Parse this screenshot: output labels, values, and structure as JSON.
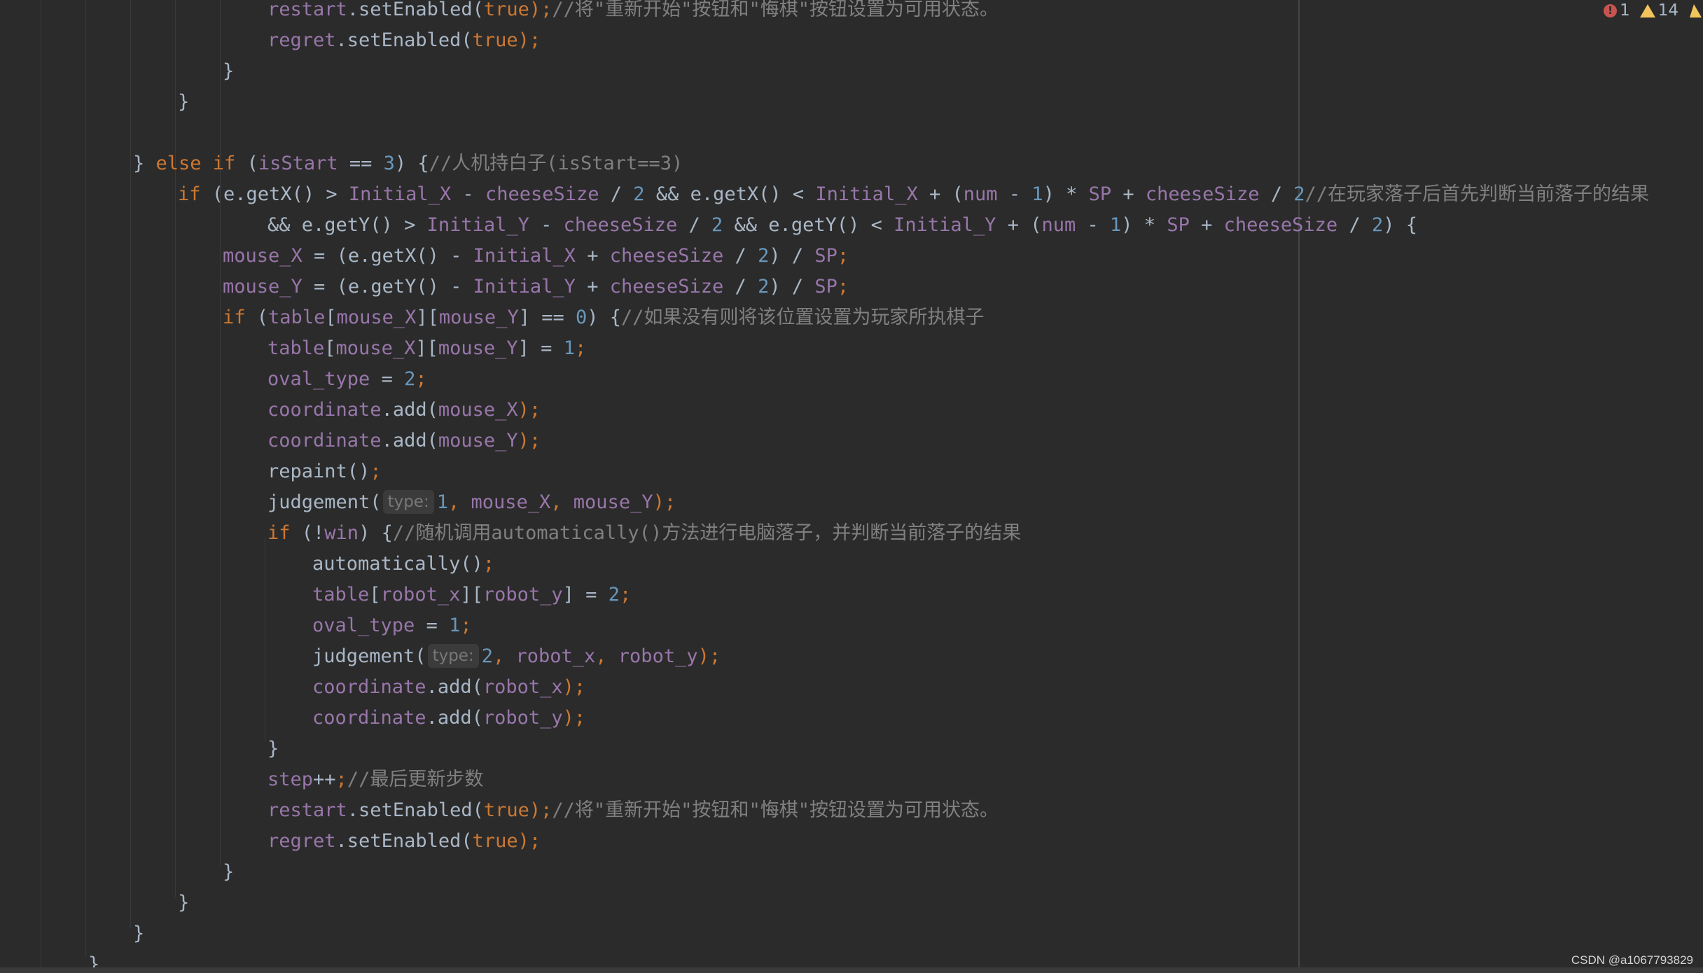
{
  "status": {
    "error_count": "1",
    "warning_count": "14",
    "error_icon": "error-circle-icon",
    "warning_icon": "warning-triangle-icon"
  },
  "watermark": "CSDN @a1067793829",
  "colors": {
    "background": "#2b2b2b",
    "keyword": "#cc7832",
    "field": "#9876aa",
    "number": "#6897bb",
    "comment": "#808080",
    "plain": "#a9b7c6"
  },
  "code_lines": [
    [
      [
        "restart",
        "fld"
      ],
      [
        ".setEnabled(",
        "pl"
      ],
      [
        "true",
        "kw"
      ],
      [
        ");",
        "kw"
      ],
      [
        "//将\"重新开始\"按钮和\"悔棋\"按钮设置为可用状态。",
        "cmt"
      ]
    ],
    [
      [
        "regret",
        "fld"
      ],
      [
        ".setEnabled(",
        "pl"
      ],
      [
        "true",
        "kw"
      ],
      [
        ");",
        "kw"
      ]
    ],
    [
      [
        "}",
        "pl"
      ]
    ],
    [
      [
        "}",
        "pl"
      ]
    ],
    [],
    [
      [
        "} ",
        "pl"
      ],
      [
        "else if ",
        "kw"
      ],
      [
        "(",
        "pl"
      ],
      [
        "isStart",
        "fld"
      ],
      [
        " == ",
        "pl"
      ],
      [
        "3",
        "num"
      ],
      [
        ") {",
        "pl"
      ],
      [
        "//人机持白子(isStart==3)",
        "cmt"
      ]
    ],
    [
      [
        "if ",
        "kw"
      ],
      [
        "(e.getX() > ",
        "pl"
      ],
      [
        "Initial_X",
        "fld"
      ],
      [
        " - ",
        "pl"
      ],
      [
        "cheeseSize",
        "fld"
      ],
      [
        " / ",
        "pl"
      ],
      [
        "2",
        "num"
      ],
      [
        " && e.getX() < ",
        "pl"
      ],
      [
        "Initial_X",
        "fld"
      ],
      [
        " + (",
        "pl"
      ],
      [
        "num",
        "fld"
      ],
      [
        " - ",
        "pl"
      ],
      [
        "1",
        "num"
      ],
      [
        ") * ",
        "pl"
      ],
      [
        "SP",
        "fld"
      ],
      [
        " + ",
        "pl"
      ],
      [
        "cheeseSize",
        "fld"
      ],
      [
        " / ",
        "pl"
      ],
      [
        "2",
        "num"
      ],
      [
        "//在玩家落子后首先判断当前落子的结果",
        "cmt"
      ]
    ],
    [
      [
        "&& e.getY() > ",
        "pl"
      ],
      [
        "Initial_Y",
        "fld"
      ],
      [
        " - ",
        "pl"
      ],
      [
        "cheeseSize",
        "fld"
      ],
      [
        " / ",
        "pl"
      ],
      [
        "2",
        "num"
      ],
      [
        " && e.getY() < ",
        "pl"
      ],
      [
        "Initial_Y",
        "fld"
      ],
      [
        " + (",
        "pl"
      ],
      [
        "num",
        "fld"
      ],
      [
        " - ",
        "pl"
      ],
      [
        "1",
        "num"
      ],
      [
        ") * ",
        "pl"
      ],
      [
        "SP",
        "fld"
      ],
      [
        " + ",
        "pl"
      ],
      [
        "cheeseSize",
        "fld"
      ],
      [
        " / ",
        "pl"
      ],
      [
        "2",
        "num"
      ],
      [
        ") {",
        "pl"
      ]
    ],
    [
      [
        "mouse_X",
        "fld"
      ],
      [
        " = (e.getX() - ",
        "pl"
      ],
      [
        "Initial_X",
        "fld"
      ],
      [
        " + ",
        "pl"
      ],
      [
        "cheeseSize",
        "fld"
      ],
      [
        " / ",
        "pl"
      ],
      [
        "2",
        "num"
      ],
      [
        ") / ",
        "pl"
      ],
      [
        "SP",
        "fld"
      ],
      [
        ";",
        "kw"
      ]
    ],
    [
      [
        "mouse_Y",
        "fld"
      ],
      [
        " = (e.getY() - ",
        "pl"
      ],
      [
        "Initial_Y",
        "fld"
      ],
      [
        " + ",
        "pl"
      ],
      [
        "cheeseSize",
        "fld"
      ],
      [
        " / ",
        "pl"
      ],
      [
        "2",
        "num"
      ],
      [
        ") / ",
        "pl"
      ],
      [
        "SP",
        "fld"
      ],
      [
        ";",
        "kw"
      ]
    ],
    [
      [
        "if ",
        "kw"
      ],
      [
        "(",
        "pl"
      ],
      [
        "table",
        "fld"
      ],
      [
        "[",
        "pl"
      ],
      [
        "mouse_X",
        "fld"
      ],
      [
        "][",
        "pl"
      ],
      [
        "mouse_Y",
        "fld"
      ],
      [
        "] == ",
        "pl"
      ],
      [
        "0",
        "num"
      ],
      [
        ") {",
        "pl"
      ],
      [
        "//如果没有则将该位置设置为玩家所执棋子",
        "cmt"
      ]
    ],
    [
      [
        "table",
        "fld"
      ],
      [
        "[",
        "pl"
      ],
      [
        "mouse_X",
        "fld"
      ],
      [
        "][",
        "pl"
      ],
      [
        "mouse_Y",
        "fld"
      ],
      [
        "] = ",
        "pl"
      ],
      [
        "1",
        "num"
      ],
      [
        ";",
        "kw"
      ]
    ],
    [
      [
        "oval_type",
        "fld"
      ],
      [
        " = ",
        "pl"
      ],
      [
        "2",
        "num"
      ],
      [
        ";",
        "kw"
      ]
    ],
    [
      [
        "coordinate",
        "fld"
      ],
      [
        ".add(",
        "pl"
      ],
      [
        "mouse_X",
        "fld"
      ],
      [
        ");",
        "kw"
      ]
    ],
    [
      [
        "coordinate",
        "fld"
      ],
      [
        ".add(",
        "pl"
      ],
      [
        "mouse_Y",
        "fld"
      ],
      [
        ");",
        "kw"
      ]
    ],
    [
      [
        "repaint()",
        "pl"
      ],
      [
        ";",
        "kw"
      ]
    ],
    [
      [
        "judgement(",
        "pl"
      ],
      [
        "type:",
        "hint"
      ],
      [
        "1",
        "num"
      ],
      [
        ", ",
        "kw"
      ],
      [
        "mouse_X",
        "fld"
      ],
      [
        ", ",
        "kw"
      ],
      [
        "mouse_Y",
        "fld"
      ],
      [
        ");",
        "kw"
      ]
    ],
    [
      [
        "if ",
        "kw"
      ],
      [
        "(!",
        "pl"
      ],
      [
        "win",
        "fld"
      ],
      [
        ") {",
        "pl"
      ],
      [
        "//随机调用automatically()方法进行电脑落子，并判断当前落子的结果",
        "cmt"
      ]
    ],
    [
      [
        "automatically()",
        "pl"
      ],
      [
        ";",
        "kw"
      ]
    ],
    [
      [
        "table",
        "fld"
      ],
      [
        "[",
        "pl"
      ],
      [
        "robot_x",
        "fld"
      ],
      [
        "][",
        "pl"
      ],
      [
        "robot_y",
        "fld"
      ],
      [
        "] = ",
        "pl"
      ],
      [
        "2",
        "num"
      ],
      [
        ";",
        "kw"
      ]
    ],
    [
      [
        "oval_type",
        "fld"
      ],
      [
        " = ",
        "pl"
      ],
      [
        "1",
        "num"
      ],
      [
        ";",
        "kw"
      ]
    ],
    [
      [
        "judgement(",
        "pl"
      ],
      [
        "type:",
        "hint"
      ],
      [
        "2",
        "num"
      ],
      [
        ", ",
        "kw"
      ],
      [
        "robot_x",
        "fld"
      ],
      [
        ", ",
        "kw"
      ],
      [
        "robot_y",
        "fld"
      ],
      [
        ");",
        "kw"
      ]
    ],
    [
      [
        "coordinate",
        "fld"
      ],
      [
        ".add(",
        "pl"
      ],
      [
        "robot_x",
        "fld"
      ],
      [
        ");",
        "kw"
      ]
    ],
    [
      [
        "coordinate",
        "fld"
      ],
      [
        ".add(",
        "pl"
      ],
      [
        "robot_y",
        "fld"
      ],
      [
        ");",
        "kw"
      ]
    ],
    [
      [
        "}",
        "pl"
      ]
    ],
    [
      [
        "step",
        "fld"
      ],
      [
        "++",
        "pl"
      ],
      [
        ";",
        "kw"
      ],
      [
        "//最后更新步数",
        "cmt"
      ]
    ],
    [
      [
        "restart",
        "fld"
      ],
      [
        ".setEnabled(",
        "pl"
      ],
      [
        "true",
        "kw"
      ],
      [
        ");",
        "kw"
      ],
      [
        "//将\"重新开始\"按钮和\"悔棋\"按钮设置为可用状态。",
        "cmt"
      ]
    ],
    [
      [
        "regret",
        "fld"
      ],
      [
        ".setEnabled(",
        "pl"
      ],
      [
        "true",
        "kw"
      ],
      [
        ");",
        "kw"
      ]
    ],
    [
      [
        "}",
        "pl"
      ]
    ],
    [
      [
        "}",
        "pl"
      ]
    ],
    [
      [
        "}",
        "pl"
      ]
    ],
    [
      [
        "}",
        "pl"
      ]
    ]
  ]
}
